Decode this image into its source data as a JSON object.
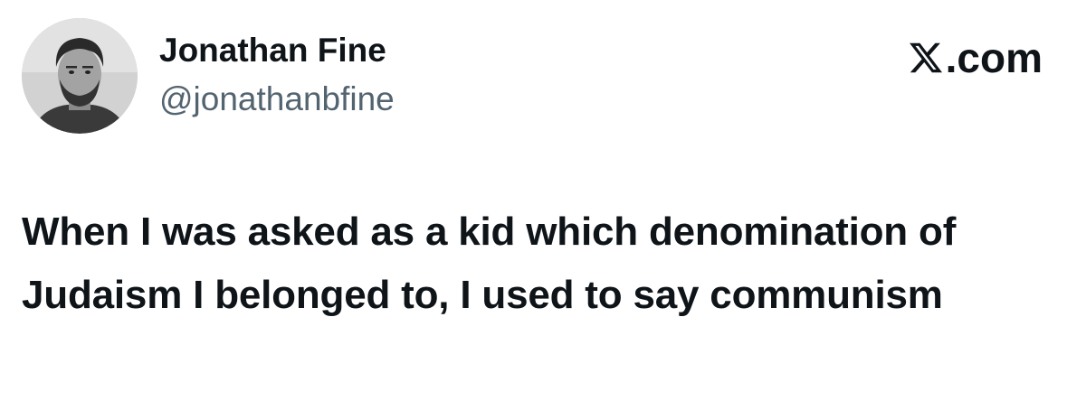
{
  "post": {
    "author": {
      "display_name": "Jonathan Fine",
      "handle": "@jonathanbfine",
      "avatar": "avatar-photo-grayscale"
    },
    "brand": {
      "icon": "x-logo-icon",
      "suffix": ".com"
    },
    "text": "When I was asked as a kid which denomination of Judaism I belonged to, I used to say communism"
  },
  "colors": {
    "text_primary": "#0f1419",
    "text_secondary": "#536471",
    "background": "#ffffff"
  }
}
